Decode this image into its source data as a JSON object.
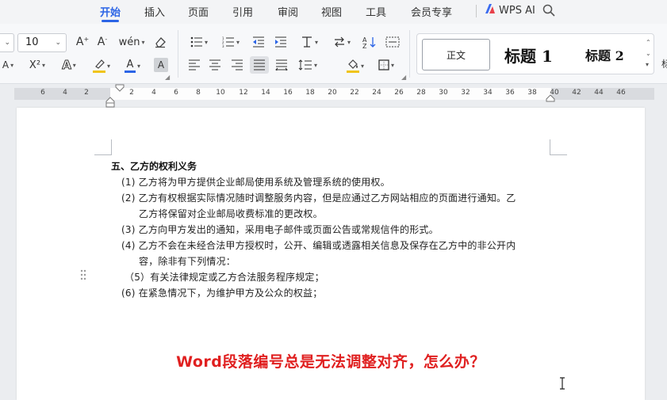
{
  "tabs": [
    {
      "label": "开始",
      "active": true
    },
    {
      "label": "插入",
      "active": false
    },
    {
      "label": "页面",
      "active": false
    },
    {
      "label": "引用",
      "active": false
    },
    {
      "label": "审阅",
      "active": false
    },
    {
      "label": "视图",
      "active": false
    },
    {
      "label": "工具",
      "active": false
    },
    {
      "label": "会员专享",
      "active": false
    }
  ],
  "wps_ai": {
    "label": "WPS AI",
    "icon": "wps-ai-logo-icon"
  },
  "ribbon": {
    "font_size": "10",
    "styles": {
      "normal": "正文",
      "heading1": "标题 1",
      "heading2": "标题 2"
    },
    "edge_char": "标"
  },
  "ruler": {
    "labels": [
      "6",
      "4",
      "2",
      "2",
      "4",
      "6",
      "8",
      "10",
      "12",
      "14",
      "16",
      "18",
      "20",
      "22",
      "24",
      "26",
      "28",
      "30",
      "32",
      "34",
      "36",
      "38",
      "40",
      "42",
      "44",
      "46"
    ]
  },
  "document": {
    "section_title": "五、乙方的权利义务",
    "items": [
      {
        "text": "(1) 乙方将为甲方提供企业邮局使用系统及管理系统的使用权。"
      },
      {
        "text": "(2) 乙方有权根据实际情况随时调整服务内容，但是应通过乙方网站相应的页面进行通知。乙"
      },
      {
        "text": "乙方将保留对企业邮局收费标准的更改权。"
      },
      {
        "text": "(3) 乙方向甲方发出的通知，采用电子邮件或页面公告或常规信件的形式。"
      },
      {
        "text": "(4) 乙方不会在未经合法甲方授权时，公开、编辑或透露相关信息及保存在乙方中的非公开内"
      },
      {
        "text": "容，除非有下列情况："
      },
      {
        "text": "（5）有关法律规定或乙方合法服务程序规定；"
      },
      {
        "text": "(6)  在紧急情况下，为维护甲方及公众的权益；"
      }
    ]
  },
  "overlay_headline": "Word段落编号总是无法调整对齐，怎么办？",
  "colors": {
    "accent": "#2b64e6",
    "headline": "#e02020",
    "font_color_bar": "#2b64e6",
    "highlight_bar": "#f0c419"
  }
}
